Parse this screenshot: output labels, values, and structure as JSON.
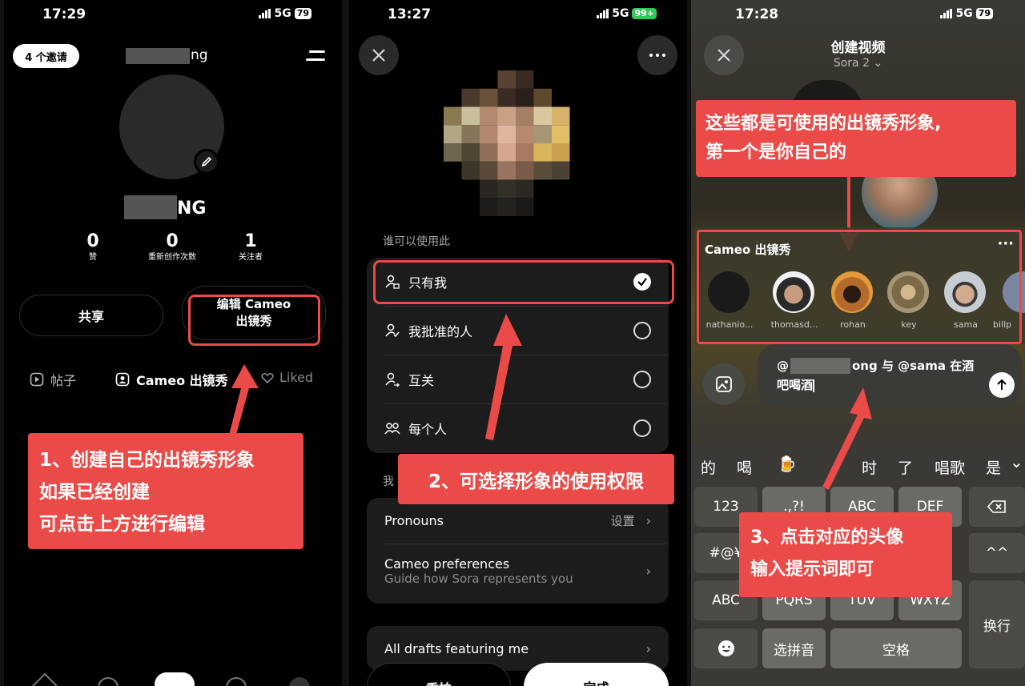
{
  "panel1": {
    "time": "17:29",
    "network": "5G",
    "battery": "79",
    "invite_chip": "4 个邀请",
    "username_partial": "ng",
    "display_name_partial": "NG",
    "stats": [
      {
        "value": "0",
        "label": "赞"
      },
      {
        "value": "0",
        "label": "重新创作次数"
      },
      {
        "value": "1",
        "label": "关注者"
      }
    ],
    "share_button": "共享",
    "edit_cameo_line1": "编辑 Cameo",
    "edit_cameo_line2": "出镜秀",
    "tabs": [
      "帖子",
      "Cameo 出镜秀",
      "Liked"
    ],
    "callout_line1": "1、创建自己的出镜秀形象",
    "callout_line2": "如果已经创建",
    "callout_line3": "可点击上方进行编辑"
  },
  "panel2": {
    "time": "13:27",
    "network": "5G",
    "battery": "99+",
    "section_label": "谁可以使用此",
    "options": [
      {
        "label": "只有我",
        "selected": true
      },
      {
        "label": "我批准的人",
        "selected": false
      },
      {
        "label": "互关",
        "selected": false
      },
      {
        "label": "每个人",
        "selected": false
      }
    ],
    "section2_label_partial": "我",
    "pronouns_label": "Pronouns",
    "pronouns_value": "设置",
    "cameo_pref_title": "Cameo preferences",
    "cameo_pref_sub": "Guide how Sora represents you",
    "drafts_label": "All drafts featuring me",
    "reshoot_button": "重拍",
    "done_button": "完成",
    "callout": "2、可选择形象的使用权限"
  },
  "panel3": {
    "time": "17:28",
    "network": "5G",
    "battery": "79",
    "title": "创建视频",
    "model": "Sora 2",
    "callout_top_line1": "这些都是可使用的出镜秀形象,",
    "callout_top_line2": "第一个是你自己的",
    "cameo_header": "Cameo 出镜秀",
    "cameos": [
      {
        "name": "nathanio...",
        "color": "#1a1a1a"
      },
      {
        "name": "thomasd...",
        "color": "#f2f2f2"
      },
      {
        "name": "rohan",
        "color": "#c7742a"
      },
      {
        "name": "key",
        "color": "#9b8b62"
      },
      {
        "name": "sama",
        "color": "#b9c2c9"
      },
      {
        "name": "billp",
        "color": "#7a86a0"
      }
    ],
    "prompt_line1_prefix": "@",
    "prompt_line1_suffix": "ong 与 @sama 在酒",
    "prompt_line2": "吧喝酒",
    "suggestions": [
      "的",
      "喝",
      "🍺",
      "时",
      "了",
      "唱歌",
      "是"
    ],
    "keys": {
      "k123": "123",
      "kpunct": ".,?!",
      "kabc": "ABC",
      "kdef": "DEF",
      "ksym": "#@¥",
      "kabc2": "ABC",
      "kpqrs": "PQRS",
      "ktuv": "TUV",
      "kwxyz": "WXYZ",
      "kswitch": "换行",
      "kpinyin": "选拼音",
      "kspace": "空格",
      "kcaret": "^^"
    },
    "callout_bottom_line1": "3、点击对应的头像",
    "callout_bottom_line2": "输入提示词即可"
  },
  "colors": {
    "callout": "#ea4b48",
    "battery_green": "#34c759"
  }
}
